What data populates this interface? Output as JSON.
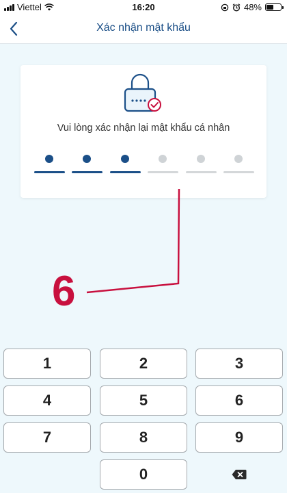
{
  "status_bar": {
    "carrier": "Viettel",
    "time": "16:20",
    "battery_percent": "48%",
    "battery_level": 0.48
  },
  "nav": {
    "title": "Xác nhận mật khẩu",
    "back_icon": "chevron-left-icon"
  },
  "card": {
    "prompt": "Vui lòng xác nhận lại mật khẩu cá nhân",
    "icon": "lock-check-icon",
    "pin_length": 6,
    "pin_filled": 3
  },
  "annotation": {
    "label": "6",
    "color": "#c8103e"
  },
  "keypad": {
    "keys": [
      "1",
      "2",
      "3",
      "4",
      "5",
      "6",
      "7",
      "8",
      "9",
      "0"
    ],
    "backspace_icon": "backspace-icon"
  },
  "colors": {
    "accent": "#1b4f88",
    "background": "#eef8fc",
    "inactive": "#cfd3d6"
  }
}
